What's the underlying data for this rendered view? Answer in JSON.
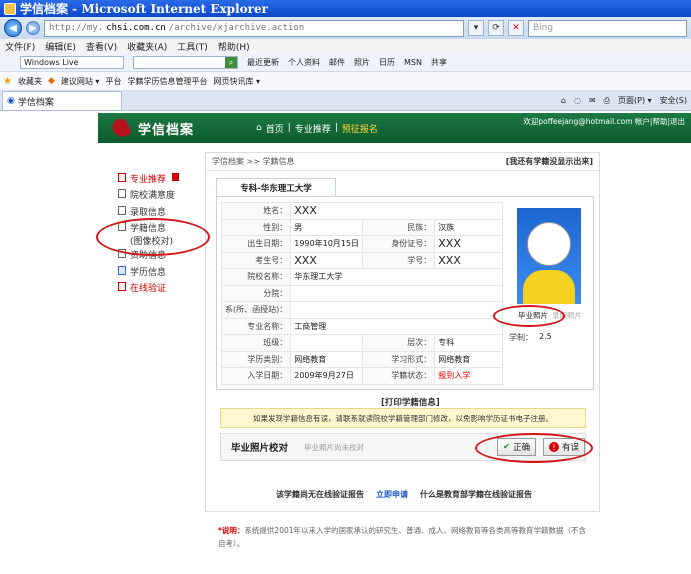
{
  "window": {
    "title": "学信档案 - Microsoft Internet Explorer",
    "url_prefix": "http://my.",
    "url_host": "chsi.com.cn",
    "url_path": "/archive/xjarchive.action",
    "search_placeholder": "Bing"
  },
  "menu": [
    "文件(F)",
    "编辑(E)",
    "查看(V)",
    "收藏夹(A)",
    "工具(T)",
    "帮助(H)"
  ],
  "toolbar1": {
    "windows_live": "Windows Live",
    "items": [
      "最近更新",
      "个人资料",
      "邮件",
      "照片",
      "日历",
      "MSN",
      "共享"
    ]
  },
  "favorites_bar": {
    "label": "收藏夹",
    "items": [
      "建议网站 ▾",
      "平台",
      "学籍学历信息管理平台",
      "网页快讯库 ▾"
    ]
  },
  "tab": {
    "label": "学信档案",
    "tools": [
      "页面(P) ▾",
      "安全(S)"
    ]
  },
  "site": {
    "brand": "学信档案",
    "nav": [
      "首页",
      "专业推荐",
      "预征报名"
    ],
    "nav_sep": "|",
    "user_links": "欢迎poffeejang@hotmail.com 帐户|帮助|退出"
  },
  "leftnav": [
    {
      "label": "专业推荐",
      "red": true
    },
    {
      "label": "院校满意度"
    },
    {
      "label": "录取信息"
    },
    {
      "label": "学籍信息",
      "sub": "(图像校对)"
    },
    {
      "label": "资助信息"
    },
    {
      "label": "学历信息"
    },
    {
      "label": "在线验证",
      "red": true
    }
  ],
  "content": {
    "breadcrumb": "学信档案 >> 学籍信息",
    "report_link": "[我还有学籍没显示出来]",
    "school_tab": "专科-华东理工大学",
    "fields": {
      "name_label": "姓名：",
      "name": "XXX",
      "gender_label": "性别：",
      "gender": "男",
      "ethnicity_label": "民族：",
      "ethnicity": "汉族",
      "birth_label": "出生日期：",
      "birth": "1990年10月15日",
      "id_label": "身份证号：",
      "id": "XXX",
      "exam_label": "考生号：",
      "exam": "XXX",
      "student_label": "学号：",
      "student": "XXX",
      "school_label": "院校名称：",
      "school": "华东理工大学",
      "branch_label": "分院：",
      "branch": "",
      "dept_label": "系(所、函授站)：",
      "dept": "",
      "major_label": "专业名称：",
      "major": "工商管理",
      "class_label": "班级：",
      "class": "",
      "level_label": "层次：",
      "level": "专科",
      "years_label": "学制：",
      "years": "2.5",
      "type_label": "学历类别：",
      "type": "网络教育",
      "form_label": "学习形式：",
      "form": "网络教育",
      "enroll_label": "入学日期：",
      "enroll": "2009年9月27日",
      "status_label": "学籍状态：",
      "status": "报到入学"
    },
    "photo_caption": "毕业照片",
    "photo_caption_alt": "录取照片",
    "print_link": "[打印学籍信息]",
    "warning": "如果发现学籍信息有误，请联系就读院校学籍管理部门修改，以免影响学历证书电子注册。",
    "check_title": "毕业照片校对",
    "check_hint": "毕业照片尚未校对",
    "btn_ok": "正确",
    "btn_bad": "有误",
    "verify_text": "该学籍尚无在线验证报告",
    "verify_apply": "立即申请",
    "verify_what": "什么是教育部学籍在线验证报告"
  },
  "footer_note": {
    "star": "*说明：",
    "text": "系统提供2001年以来入学的国家承认的研究生、普通、成人、网络教育等各类高等教育学籍数据（不含自考）。"
  },
  "colors": {
    "header_green": "#1b7a43",
    "highlight": "#ffd83a",
    "annotation_red": "#d21818"
  }
}
